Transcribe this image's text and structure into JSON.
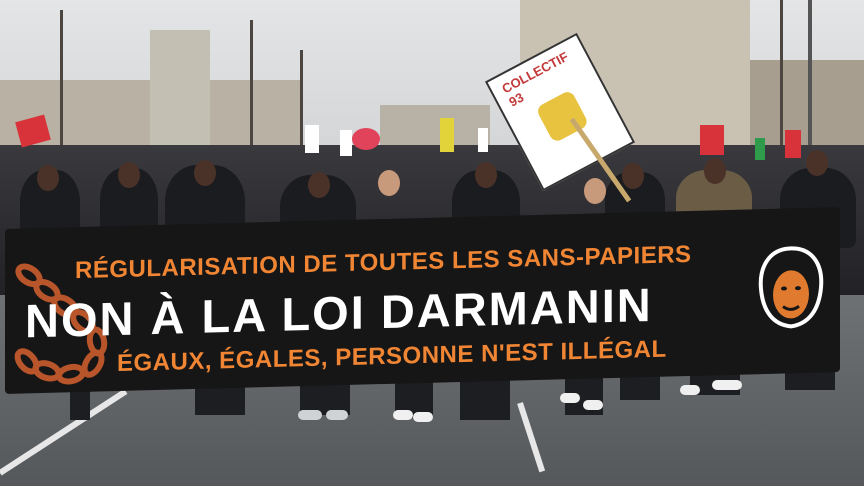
{
  "scene": {
    "description_alt": ""
  },
  "banner": {
    "line1": "RÉGULARISATION DE TOUTES LES SANS-PAPIERS",
    "line2": "NON À LA LOI DARMANIN",
    "line3": "ÉGAUX, ÉGALES, PERSONNE N'EST ILLÉGAL"
  },
  "placard": {
    "text": "COLLECTIF 93"
  },
  "colors": {
    "banner_bg": "#161616",
    "banner_orange": "#f08534",
    "banner_white": "#ffffff",
    "flag_red": "#d8333a",
    "flag_yellow": "#e3d33a"
  }
}
